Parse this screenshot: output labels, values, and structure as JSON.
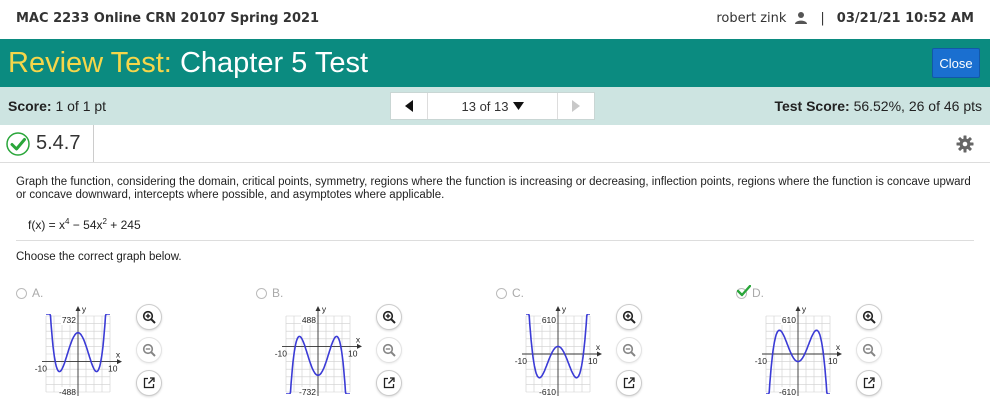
{
  "header": {
    "course": "MAC 2233 Online CRN 20107 Spring 2021",
    "user": "robert zink",
    "separator": "|",
    "datetime": "03/21/21 10:52 AM"
  },
  "titlebar": {
    "title_prefix": "Review Test:",
    "title_rest": "Chapter 5 Test",
    "close_label": "Close"
  },
  "scorebar": {
    "score_label": "Score:",
    "score_value": "1 of 1 pt",
    "nav_position": "13 of 13",
    "test_score_label": "Test Score:",
    "test_score_value": "56.52%, 26 of 46 pts"
  },
  "question": {
    "id": "5.4.7",
    "prompt": "Graph the function, considering the domain, critical points, symmetry, regions where the function is increasing or decreasing, inflection points, regions where the function is concave upward or concave downward, intercepts where possible, and asymptotes where applicable.",
    "function_prefix": "f(x) = x",
    "exp1": "4",
    "function_mid": " − 54x",
    "exp2": "2",
    "function_suffix": " + 245",
    "choose_text": "Choose the correct graph below."
  },
  "options": [
    {
      "letter": "A.",
      "y_top": "732",
      "y_bottom": "-488",
      "x_left": "-10",
      "x_right": "10",
      "axis_x": "x",
      "axis_y": "y",
      "selected": false
    },
    {
      "letter": "B.",
      "y_top": "488",
      "y_bottom": "-732",
      "x_left": "-10",
      "x_right": "10",
      "axis_x": "x",
      "axis_y": "y",
      "selected": false
    },
    {
      "letter": "C.",
      "y_top": "610",
      "y_bottom": "-610",
      "x_left": "-10",
      "x_right": "10",
      "axis_x": "x",
      "axis_y": "y",
      "selected": false
    },
    {
      "letter": "D.",
      "y_top": "610",
      "y_bottom": "-610",
      "x_left": "-10",
      "x_right": "10",
      "axis_x": "x",
      "axis_y": "y",
      "selected": true
    }
  ],
  "colors": {
    "teal": "#0b8b80",
    "title_highlight": "#f6d64a",
    "score_bar": "#cde4e1",
    "close_button": "#1a6fd0",
    "curve": "#3b3bd6",
    "check_green": "#2aa63a"
  },
  "icons": [
    "user-icon",
    "prev-arrow-icon",
    "dropdown-icon",
    "next-arrow-icon",
    "correct-check-icon",
    "gear-icon",
    "zoom-in-icon",
    "zoom-out-icon",
    "popout-icon"
  ]
}
